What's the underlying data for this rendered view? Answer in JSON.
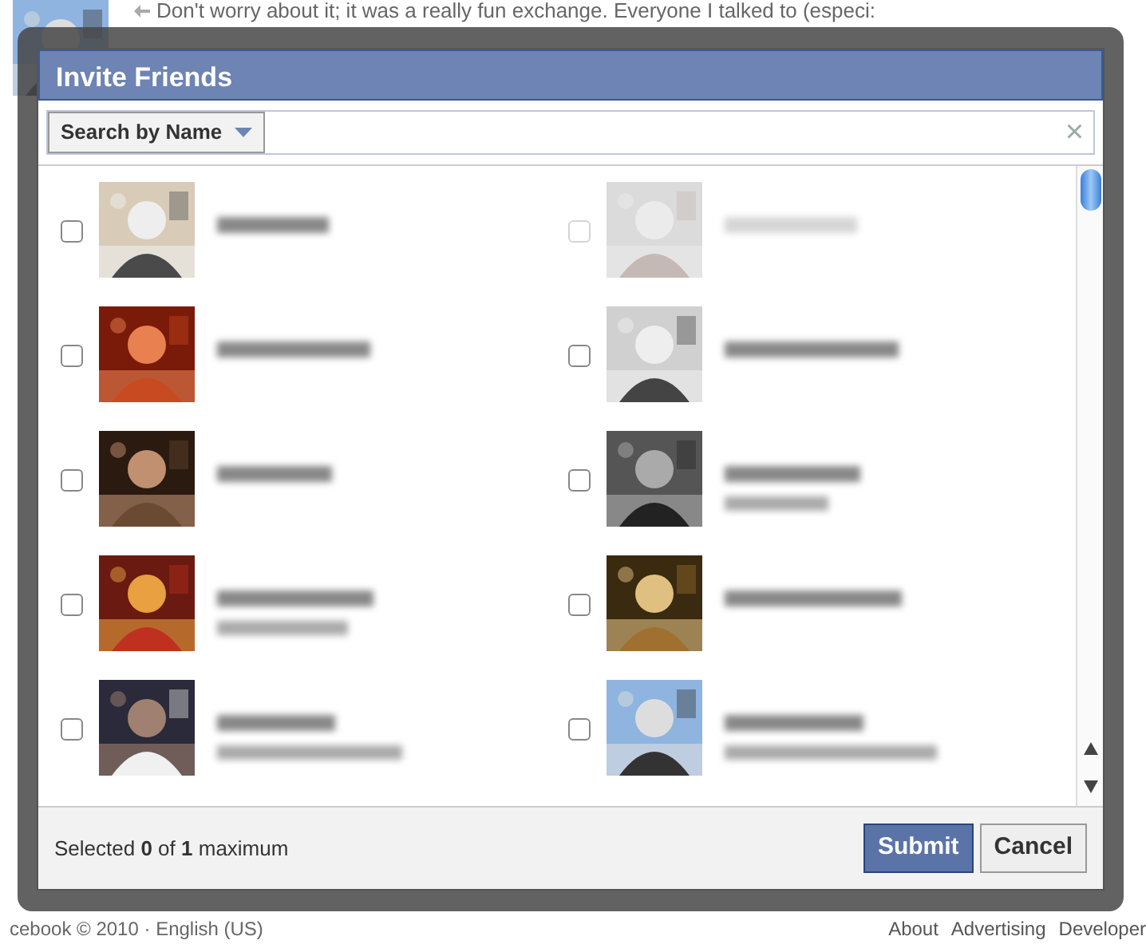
{
  "background_page": {
    "comment": "Don't worry about it; it was a really fun exchange. Everyone I talked to (especi:",
    "footer_left": "cebook © 2010 · English (US)",
    "footer_links": [
      "About",
      "Advertising",
      "Developer"
    ]
  },
  "dialog": {
    "title": "Invite Friends",
    "search": {
      "filter_label": "Search by Name",
      "clear": "×"
    },
    "friends": [
      {
        "kind": "picture",
        "disabled": false,
        "checked": false,
        "has_subtitle": false
      },
      {
        "kind": "picture",
        "disabled": true,
        "checked": false,
        "has_subtitle": false
      },
      {
        "kind": "picture",
        "disabled": false,
        "checked": false,
        "has_subtitle": false
      },
      {
        "kind": "picture",
        "disabled": false,
        "checked": false,
        "has_subtitle": false
      },
      {
        "kind": "picture",
        "disabled": false,
        "checked": false,
        "has_subtitle": false
      },
      {
        "kind": "picture",
        "disabled": false,
        "checked": false,
        "has_subtitle": true
      },
      {
        "kind": "picture",
        "disabled": false,
        "checked": false,
        "has_subtitle": true
      },
      {
        "kind": "picture",
        "disabled": false,
        "checked": false,
        "has_subtitle": false
      },
      {
        "kind": "picture",
        "disabled": false,
        "checked": false,
        "has_subtitle": true
      },
      {
        "kind": "picture",
        "disabled": false,
        "checked": false,
        "has_subtitle": true
      }
    ],
    "footer": {
      "selected_text": "Selected **0** of **1** maximum",
      "buttons": [
        {
          "label": "Submit",
          "kind": "primary"
        },
        {
          "label": "Cancel",
          "kind": "secondary"
        }
      ]
    }
  }
}
